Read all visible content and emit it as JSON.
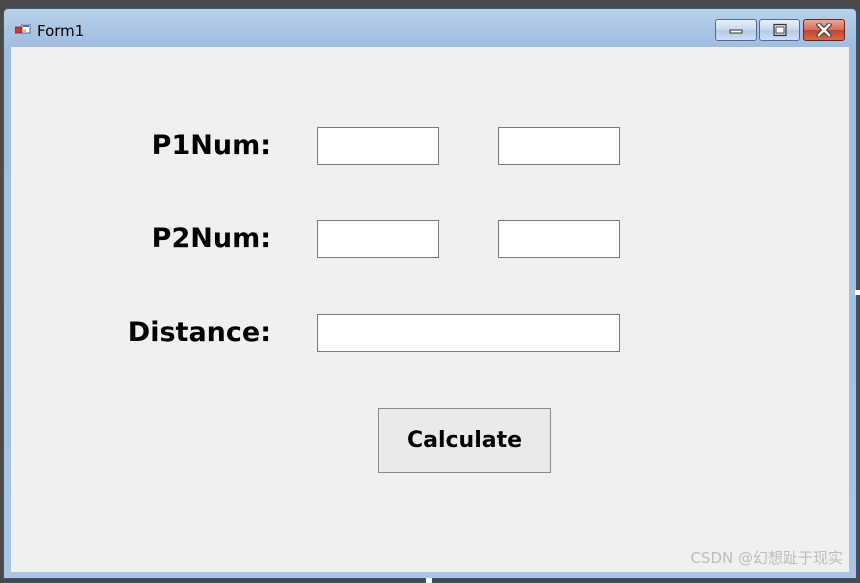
{
  "window": {
    "title": "Form1"
  },
  "form": {
    "p1_label": "P1Num:",
    "p2_label": "P2Num:",
    "distance_label": "Distance:",
    "p1_x_value": "",
    "p1_y_value": "",
    "p2_x_value": "",
    "p2_y_value": "",
    "distance_value": "",
    "calculate_label": "Calculate"
  },
  "watermark": "CSDN @幻想趾于现实",
  "icons": [
    "form-app-icon",
    "minimize-icon",
    "maximize-icon",
    "close-icon"
  ]
}
